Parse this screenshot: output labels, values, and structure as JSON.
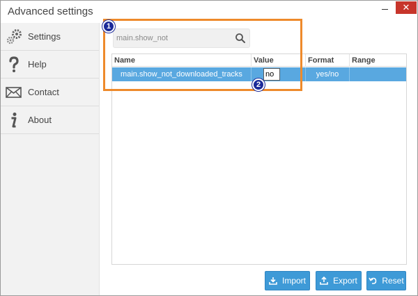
{
  "window": {
    "title": "Advanced settings",
    "close_glyph": "✕"
  },
  "sidebar": {
    "items": [
      {
        "label": "Settings",
        "icon": "gear-icon"
      },
      {
        "label": "Help",
        "icon": "question-icon"
      },
      {
        "label": "Contact",
        "icon": "envelope-icon"
      },
      {
        "label": "About",
        "icon": "info-icon"
      }
    ]
  },
  "search": {
    "value": "main.show_not",
    "icon": "search-icon"
  },
  "table": {
    "columns": [
      "Name",
      "Value",
      "Format",
      "Range"
    ],
    "rows": [
      {
        "name": "main.show_not_downloaded_tracks",
        "value": "no",
        "format": "yes/no",
        "range": ""
      }
    ]
  },
  "annotations": {
    "marker1": "1",
    "marker2": "2"
  },
  "buttons": {
    "import": "Import",
    "export": "Export",
    "reset": "Reset"
  },
  "colors": {
    "accent": "#3e9ad7",
    "row_selected": "#59a8e0",
    "highlight": "#ee8a2b",
    "marker": "#1b2a99",
    "close": "#c7352b"
  }
}
